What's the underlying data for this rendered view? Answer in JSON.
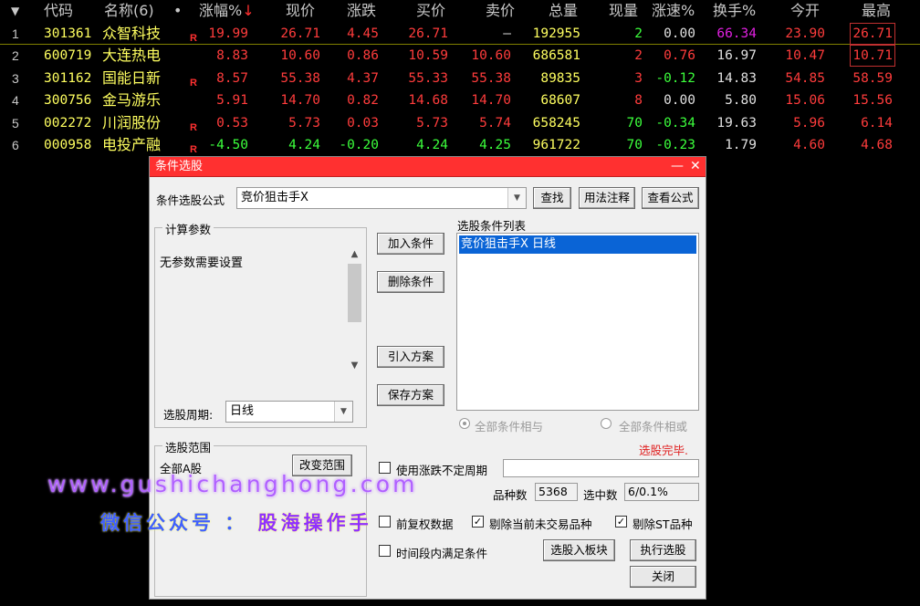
{
  "table": {
    "headers": {
      "rank": "",
      "code": "代码",
      "name": "名称(6)",
      "dot": "•",
      "pct": "涨幅%",
      "price": "现价",
      "change": "涨跌",
      "bid": "买价",
      "ask": "卖价",
      "volume": "总量",
      "cur_vol": "现量",
      "speed": "涨速%",
      "turnover": "换手%",
      "open": "今开",
      "high": "最高"
    },
    "rows": [
      {
        "rank": "1",
        "code": "301361",
        "name": "众智科技",
        "flag": "R",
        "pct": "19.99",
        "price": "26.71",
        "change": "4.45",
        "bid": "26.71",
        "ask": "—",
        "volume": "192955",
        "cur_vol": "2",
        "speed": "0.00",
        "turnover": "66.34",
        "open": "23.90",
        "high": "26.71"
      },
      {
        "rank": "2",
        "code": "600719",
        "name": "大连热电",
        "flag": "",
        "pct": "8.83",
        "price": "10.60",
        "change": "0.86",
        "bid": "10.59",
        "ask": "10.60",
        "volume": "686581",
        "cur_vol": "2",
        "speed": "0.76",
        "turnover": "16.97",
        "open": "10.47",
        "high": "10.71"
      },
      {
        "rank": "3",
        "code": "301162",
        "name": "国能日新",
        "flag": "R",
        "pct": "8.57",
        "price": "55.38",
        "change": "4.37",
        "bid": "55.33",
        "ask": "55.38",
        "volume": "89835",
        "cur_vol": "3",
        "speed": "-0.12",
        "turnover": "14.83",
        "open": "54.85",
        "high": "58.59"
      },
      {
        "rank": "4",
        "code": "300756",
        "name": "金马游乐",
        "flag": "",
        "pct": "5.91",
        "price": "14.70",
        "change": "0.82",
        "bid": "14.68",
        "ask": "14.70",
        "volume": "68607",
        "cur_vol": "8",
        "speed": "0.00",
        "turnover": "5.80",
        "open": "15.06",
        "high": "15.56"
      },
      {
        "rank": "5",
        "code": "002272",
        "name": "川润股份",
        "flag": "R",
        "pct": "0.53",
        "price": "5.73",
        "change": "0.03",
        "bid": "5.73",
        "ask": "5.74",
        "volume": "658245",
        "cur_vol": "70",
        "speed": "-0.34",
        "turnover": "19.63",
        "open": "5.96",
        "high": "6.14"
      },
      {
        "rank": "6",
        "code": "000958",
        "name": "电投产融",
        "flag": "R",
        "pct": "-4.50",
        "price": "4.24",
        "change": "-0.20",
        "bid": "4.24",
        "ask": "4.25",
        "volume": "961722",
        "cur_vol": "70",
        "speed": "-0.23",
        "turnover": "1.79",
        "open": "4.60",
        "high": "4.68"
      }
    ]
  },
  "dialog": {
    "title": "条件选股",
    "minimize": "—",
    "close": "✕",
    "formula_label": "条件选股公式",
    "formula_value": "竞价狙击手X",
    "find_button": "查找",
    "usage_button": "用法注释",
    "view_button": "查看公式",
    "params_group": "计算参数",
    "params_text": "无参数需要设置",
    "period_label": "选股周期:",
    "period_value": "日线",
    "add_button": "加入条件",
    "delete_button": "删除条件",
    "import_button": "引入方案",
    "save_button": "保存方案",
    "list_title": "选股条件列表",
    "list_item": "竞价狙击手X  日线",
    "radio_and": "全部条件相与",
    "radio_or": "全部条件相或",
    "status_text": "选股完毕.",
    "range_group": "选股范围",
    "range_value": "全部A股",
    "change_range_button": "改变范围",
    "use_period_label": "使用涨跌不定周期",
    "count_label": "品种数",
    "count_value": "5368",
    "selected_label": "选中数",
    "selected_value": "6/0.1%",
    "adjust_label": "前复权数据",
    "exclude_untraded_label": "剔除当前未交易品种",
    "exclude_st_label": "剔除ST品种",
    "time_segment_label": "时间段内满足条件",
    "to_block_button": "选股入板块",
    "run_button": "执行选股",
    "close_button": "关闭"
  },
  "watermark": {
    "site": "www.gushichanghong.com",
    "wechat_prefix": "微信公众号 ：",
    "wechat_name": "股海操作手"
  },
  "colors": {
    "up": "#ff3c3c",
    "down": "#3cff3c",
    "code": "#ffff60",
    "title_bar": "#ff3030",
    "selection": "#0a64d6"
  }
}
